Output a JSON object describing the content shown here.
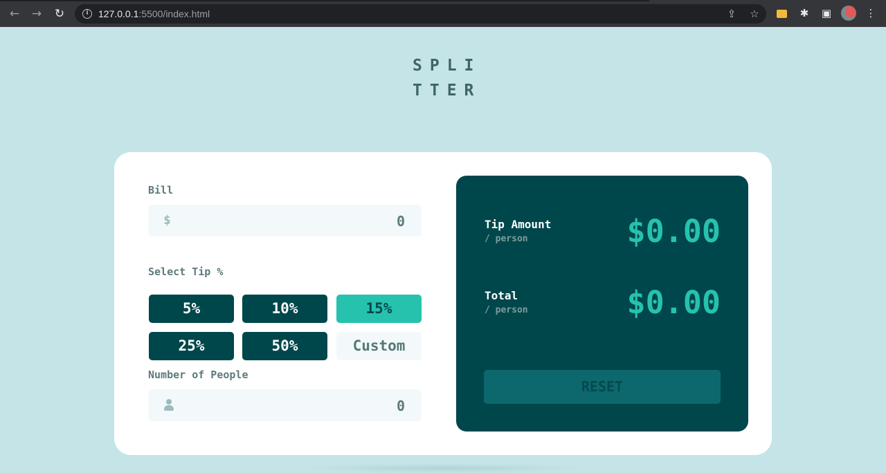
{
  "browser": {
    "url_host": "127.0.0.1",
    "url_rest": ":5500/index.html",
    "icons": {
      "back": "back-arrow-icon",
      "forward": "forward-arrow-icon",
      "reload": "reload-icon",
      "info": "info-icon",
      "share": "share-icon",
      "bookmark": "star-icon",
      "extension_folder": "folder-icon",
      "extensions": "puzzle-icon",
      "sidepanel": "side-panel-icon",
      "profile": "avatar",
      "menu": "kebab-menu-icon"
    }
  },
  "logo": {
    "line1": "SPLI",
    "line2": "TTER"
  },
  "bill": {
    "label": "Bill",
    "prefix": "$",
    "value": "0"
  },
  "tip": {
    "label": "Select Tip %",
    "options": [
      "5%",
      "10%",
      "15%",
      "25%",
      "50%"
    ],
    "selected": "15%",
    "custom_label": "Custom"
  },
  "people": {
    "label": "Number of People",
    "value": "0",
    "icon": "person-icon"
  },
  "results": {
    "tip_amount": {
      "title": "Tip Amount",
      "sub": "/ person",
      "value": "$0.00"
    },
    "total": {
      "title": "Total",
      "sub": "/ person",
      "value": "$0.00"
    },
    "reset_label": "RESET"
  },
  "colors": {
    "page_bg": "#c5e4e7",
    "dark_cyan": "#00474b",
    "strong_cyan": "#26c2ae",
    "card_bg": "#ffffff"
  }
}
